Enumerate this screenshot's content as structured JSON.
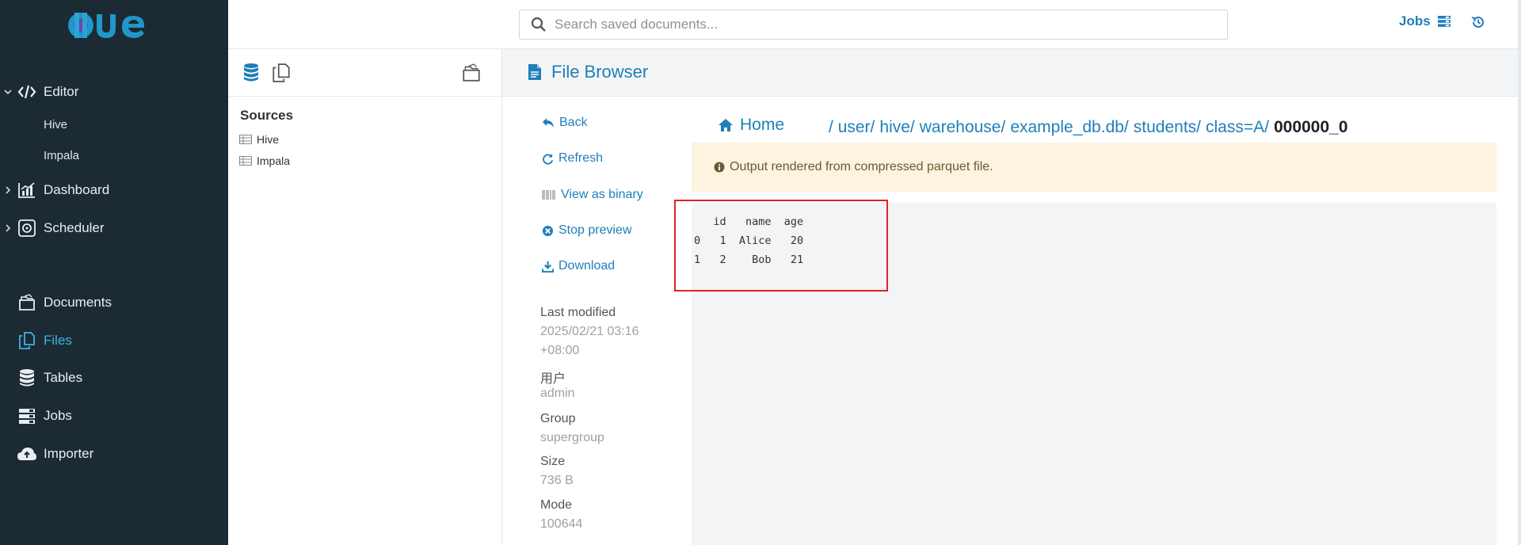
{
  "app": {
    "logo_text": "HUE"
  },
  "sidebar": {
    "editor": {
      "label": "Editor",
      "children": [
        "Hive",
        "Impala"
      ]
    },
    "dashboard": {
      "label": "Dashboard"
    },
    "scheduler": {
      "label": "Scheduler"
    },
    "documents": {
      "label": "Documents"
    },
    "files": {
      "label": "Files"
    },
    "tables": {
      "label": "Tables"
    },
    "jobs": {
      "label": "Jobs"
    },
    "importer": {
      "label": "Importer"
    },
    "active_color": "#3bb6e8",
    "bg_color": "#1c2a33"
  },
  "topbar": {
    "search_placeholder": "Search saved documents...",
    "jobs_label": "Jobs"
  },
  "assist": {
    "sources_title": "Sources",
    "sources": [
      "Hive",
      "Impala"
    ]
  },
  "main": {
    "title": "File Browser",
    "actions": {
      "back": "Back",
      "refresh": "Refresh",
      "view_binary": "View as binary",
      "stop_preview": "Stop preview",
      "download": "Download"
    },
    "meta": {
      "last_modified_label": "Last modified",
      "last_modified_value_1": "2025/02/21 03:16",
      "last_modified_value_2": "+08:00",
      "user_label": "用户",
      "user_value": "admin",
      "group_label": "Group",
      "group_value": "supergroup",
      "size_label": "Size",
      "size_value": "736 B",
      "mode_label": "Mode",
      "mode_value": "100644"
    },
    "breadcrumb": {
      "home": "Home",
      "segments": [
        "/ user/",
        "hive/",
        "warehouse/",
        "example_db.db/",
        "students/",
        "class=A/"
      ],
      "current": "000000_0"
    },
    "alert": "Output rendered from compressed parquet file.",
    "preview_text": "   id   name  age\n0   1  Alice   20\n1   2    Bob   21",
    "accent_color": "#1f7fb8",
    "highlight_color": "#e02424"
  }
}
